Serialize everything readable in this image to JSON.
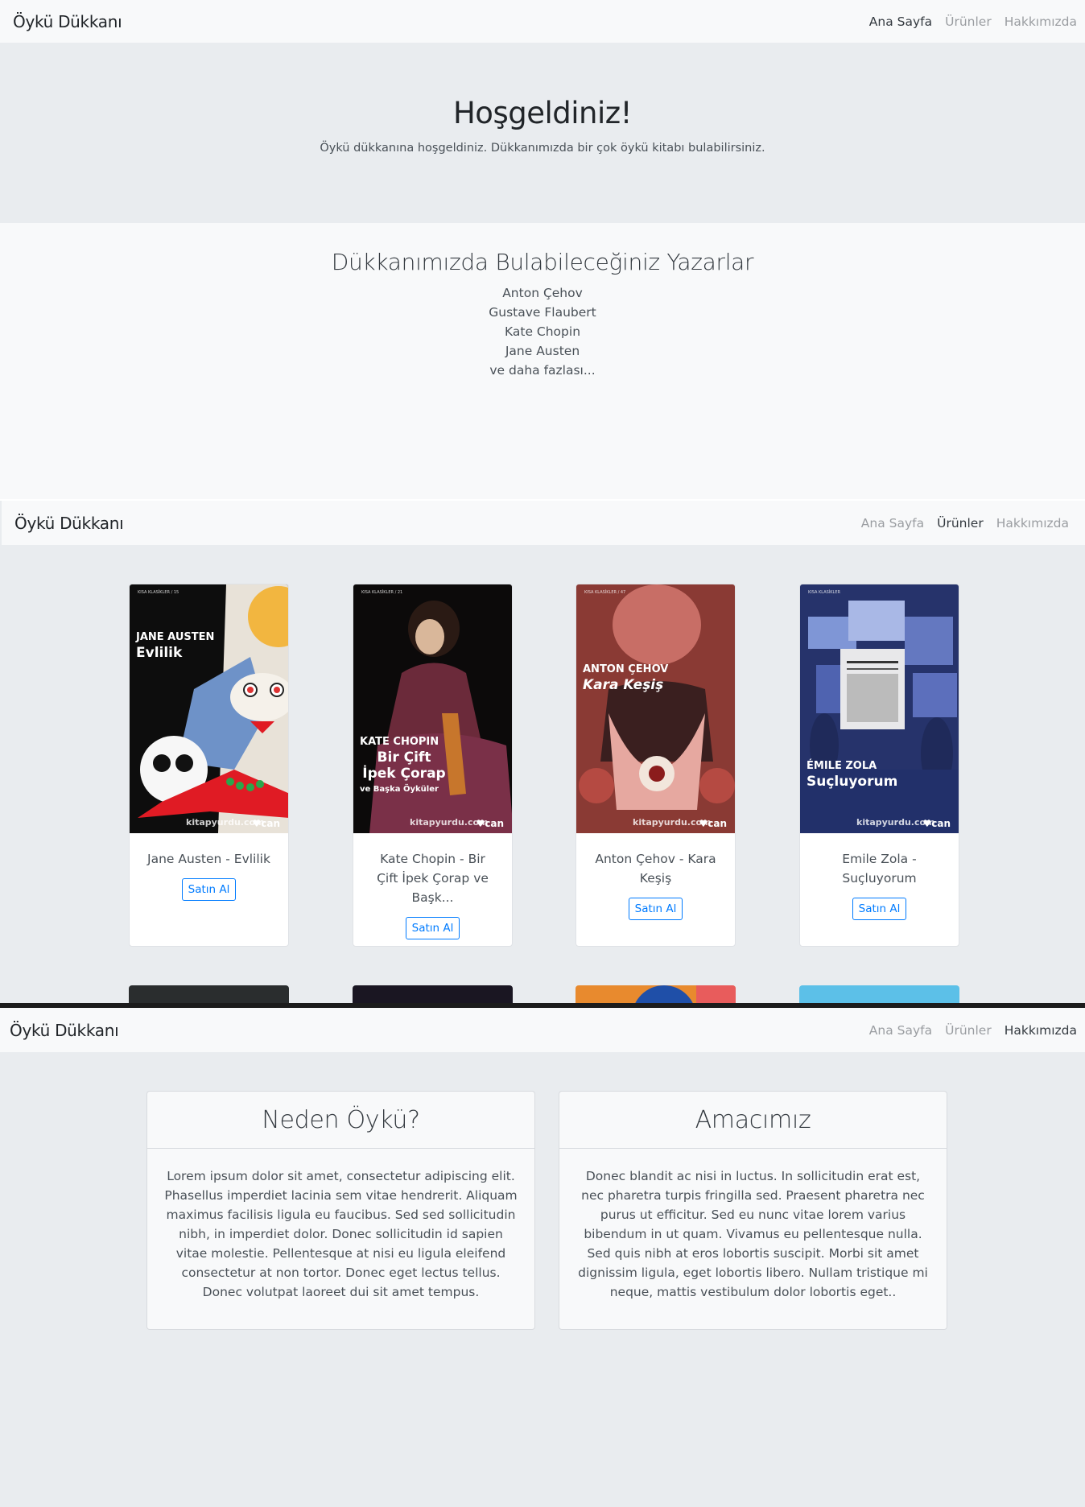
{
  "site": {
    "brand": "Öykü Dükkanı"
  },
  "nav": {
    "home": "Ana Sayfa",
    "products": "Ürünler",
    "about": "Hakkımızda"
  },
  "hero": {
    "title": "Hoşgeldiniz!",
    "text": "Öykü dükkanına hoşgeldiniz. Dükkanımızda bir çok öykü kitabı bulabilirsiniz."
  },
  "authors": {
    "heading": "Dükkanımızda Bulabileceğiniz Yazarlar",
    "items": [
      "Anton Çehov",
      "Gustave Flaubert",
      "Kate Chopin",
      "Jane Austen",
      "ve daha fazlası..."
    ]
  },
  "products": [
    {
      "name": "Jane Austen - Evlilik",
      "button": "Satın Al",
      "cover_author": "JANE AUSTEN",
      "cover_title": "Evlilik",
      "series": "KISA KLASİKLER / 15",
      "site": "kitapyurdu.com",
      "publisher": "♥can"
    },
    {
      "name": "Kate Chopin - Bir Çift İpek Çorap ve Başk...",
      "button": "Satın Al",
      "cover_author": "KATE CHOPIN",
      "cover_title": "Bir Çift İpek Çorap",
      "cover_subtitle": "ve Başka Öyküler",
      "series": "KISA KLASİKLER / 21",
      "site": "kitapyurdu.com",
      "publisher": "♥can"
    },
    {
      "name": "Anton Çehov - Kara Keşiş",
      "button": "Satın Al",
      "cover_author": "ANTON ÇEHOV",
      "cover_title": "Kara Keşiş",
      "series": "KISA KLASİKLER / 47",
      "site": "kitapyurdu.com",
      "publisher": "♥can"
    },
    {
      "name": "Emile Zola - Suçluyorum",
      "button": "Satın Al",
      "cover_author": "ÉMILE ZOLA",
      "cover_title": "Suçluyorum",
      "series": "KISA KLASİKLER",
      "site": "kitapyurdu.com",
      "publisher": "♥can"
    }
  ],
  "about": {
    "why": {
      "title": "Neden Öykü?",
      "text": "Lorem ipsum dolor sit amet, consectetur adipiscing elit. Phasellus imperdiet lacinia sem vitae hendrerit. Aliquam maximus facilisis ligula eu faucibus. Sed sed sollicitudin nibh, in imperdiet dolor. Donec sollicitudin id sapien vitae molestie. Pellentesque at nisi eu ligula eleifend consectetur at non tortor. Donec eget lectus tellus. Donec volutpat laoreet dui sit amet tempus."
    },
    "goal": {
      "title": "Amacımız",
      "text": "Donec blandit ac nisi in luctus. In sollicitudin erat est, nec pharetra turpis fringilla sed. Praesent pharetra nec purus ut efficitur. Sed eu nunc vitae lorem varius bibendum in ut quam. Vivamus eu pellentesque nulla. Sed quis nibh at eros lobortis suscipit. Morbi sit amet dignissim ligula, eget lobortis libero. Nullam tristique mi neque, mattis vestibulum dolor lobortis eget.."
    }
  },
  "colors": {
    "navbar": "#f8f9fa",
    "jumbotron": "#e9ecef",
    "primary": "#007bff"
  }
}
